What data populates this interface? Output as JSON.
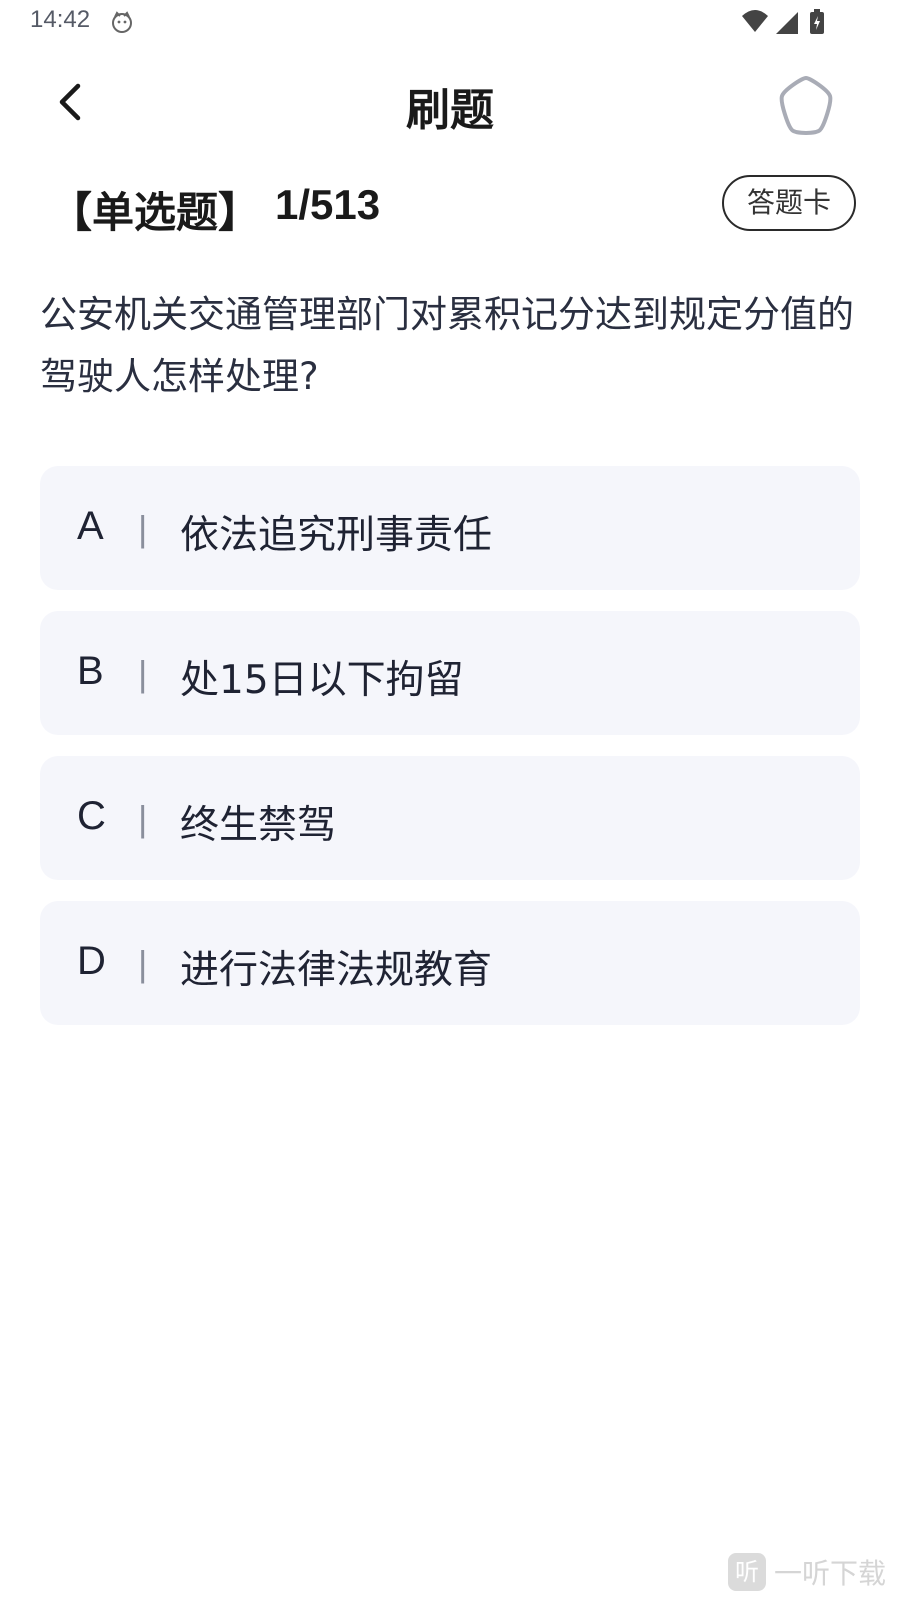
{
  "status_bar": {
    "time": "14:42",
    "icons": [
      "cat-face-icon",
      "wifi-icon",
      "signal-icon",
      "battery-charging-icon"
    ]
  },
  "header": {
    "title": "刷题",
    "back_icon": "chevron-left-icon",
    "favorite_icon": "star-outline-icon"
  },
  "question": {
    "type_label": "【单选题】",
    "progress": "1/513",
    "answer_card_label": "答题卡",
    "text": "公安机关交通管理部门对累积记分达到规定分值的驾驶人怎样处理?",
    "separator": "|",
    "options": [
      {
        "letter": "A",
        "text": "依法追究刑事责任"
      },
      {
        "letter": "B",
        "text": "处15日以下拘留"
      },
      {
        "letter": "C",
        "text": "终生禁驾"
      },
      {
        "letter": "D",
        "text": "进行法律法规教育"
      }
    ]
  },
  "watermark": {
    "icon_char": "听",
    "text": "一听下载"
  },
  "colors": {
    "option_bg": "#f5f6fb",
    "text_primary": "#1f2333",
    "separator": "#8a8f9c"
  }
}
